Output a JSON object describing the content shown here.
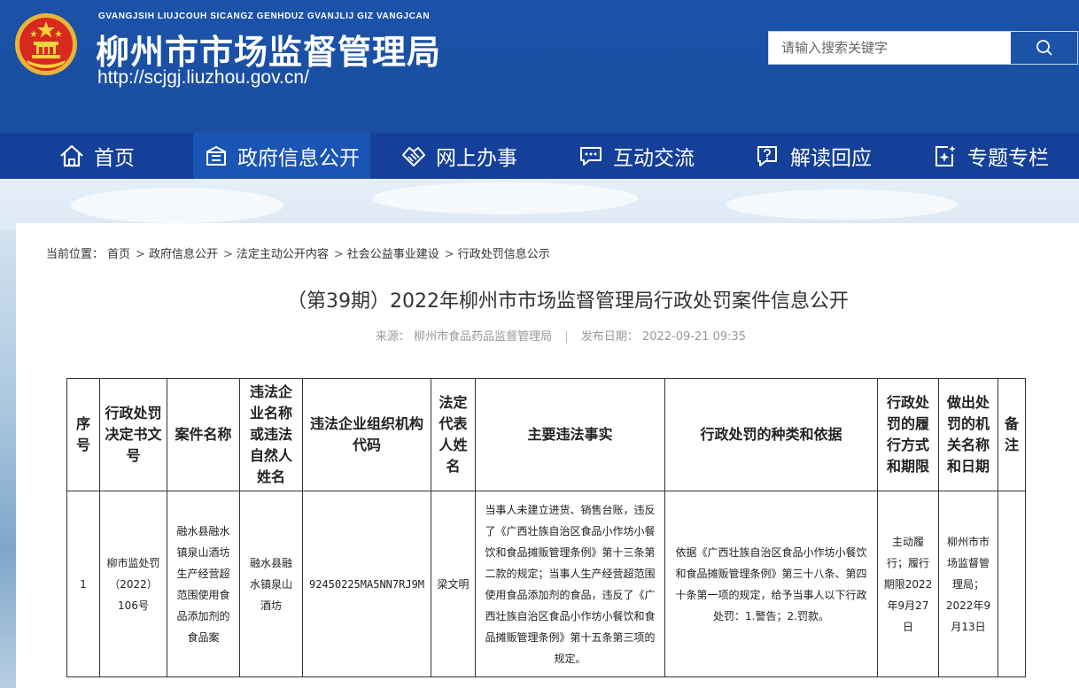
{
  "header": {
    "pinyin": "GVANGJSIH LIUJCOUH SICANGZ GENHDUZ GVANJLIJ GIZ VANGJCAN",
    "site_name": "柳州市市场监督管理局",
    "site_url": "http://scjgj.liuzhou.gov.cn/",
    "search_placeholder": "请输入搜索关键字"
  },
  "nav": {
    "items": [
      {
        "label": "首页",
        "icon": "home-icon"
      },
      {
        "label": "政府信息公开",
        "icon": "building-icon"
      },
      {
        "label": "网上办事",
        "icon": "handshake-icon"
      },
      {
        "label": "互动交流",
        "icon": "chat-icon"
      },
      {
        "label": "解读回应",
        "icon": "question-chat-icon"
      },
      {
        "label": "专题专栏",
        "icon": "spark-doc-icon"
      }
    ]
  },
  "breadcrumb": {
    "prefix": "当前位置：",
    "items": [
      "首页",
      "政府信息公开",
      "法定主动公开内容",
      "社会公益事业建设",
      "行政处罚信息公示"
    ],
    "separator": ">"
  },
  "article": {
    "title": "（第39期）2022年柳州市市场监督管理局行政处罚案件信息公开",
    "source_label": "来源：",
    "source": "柳州市食品药品监督管理局",
    "divider": "|",
    "date_label": "发布日期：",
    "date": "2022-09-21 09:35"
  },
  "table": {
    "headers": [
      "序号",
      "行政处罚决定书文号",
      "案件名称",
      "违法企业名称或违法自然人姓名",
      "违法企业组织机构代码",
      "法定代表人姓名",
      "主要违法事实",
      "行政处罚的种类和依据",
      "行政处罚的履行方式和期限",
      "做出处罚的机关名称和日期",
      "备注"
    ],
    "rows": [
      [
        "1",
        "柳市监处罚（2022）106号",
        "融水县融水镇泉山酒坊生产经营超范围使用食品添加剂的食品案",
        "融水县融水镇泉山酒坊",
        "92450225MA5NN7RJ9M",
        "梁文明",
        "当事人未建立进货、销售台账，违反了《广西壮族自治区食品小作坊小餐饮和食品摊贩管理条例》第十三条第二款的规定；当事人生产经营超范围使用食品添加剂的食品，违反了《广西壮族自治区食品小作坊小餐饮和食品摊贩管理条例》第十五条第三项的规定。",
        "依据《广西壮族自治区食品小作坊小餐饮和食品摊贩管理条例》第三十八条、第四十条第一项的规定，给予当事人以下行政处罚：1.警告；2.罚款。",
        "主动履行；履行期限2022年9月27日",
        "柳州市市场监督管理局；2022年9月13日",
        ""
      ]
    ]
  },
  "colors": {
    "header_bg": "#1b53a8",
    "nav_bg": "#14409a",
    "nav_active": "#1a54b4"
  }
}
